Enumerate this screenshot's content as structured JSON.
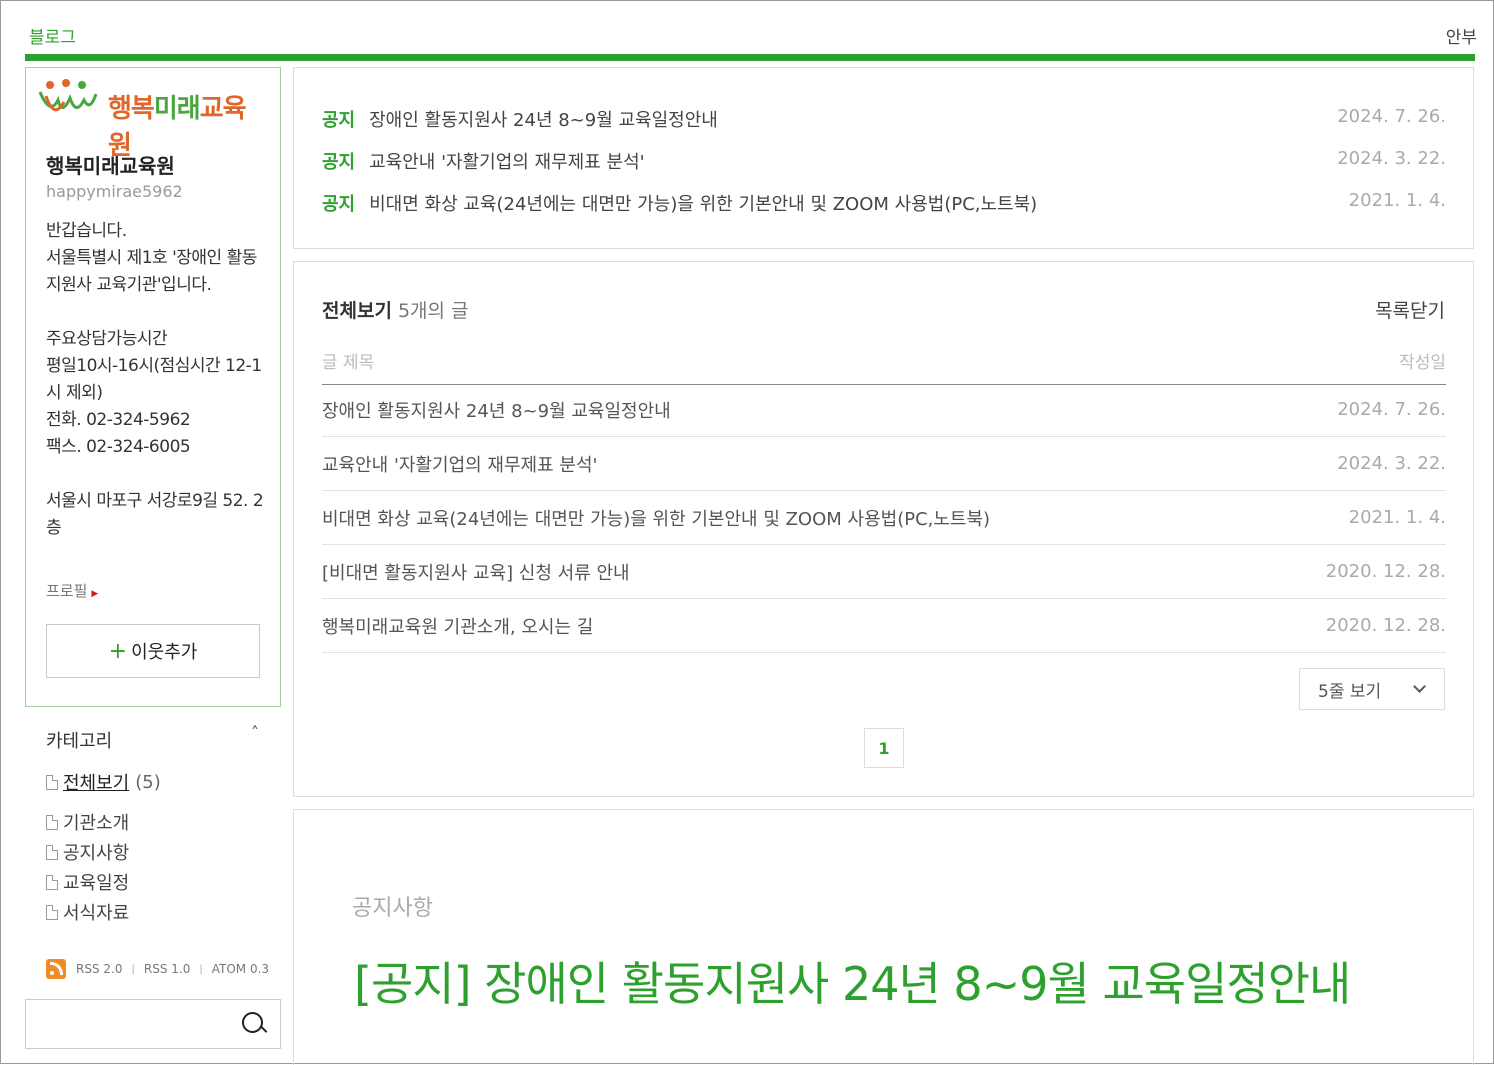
{
  "header": {
    "brand": "블로그",
    "signin": "안부"
  },
  "profile": {
    "logo_text_orange": "행복",
    "logo_text_green": "미래",
    "logo_text_rest": "교육원",
    "name": "행복미래교육원",
    "id": "happymirae5962",
    "intro": "반갑습니다.\n서울특별시 제1호 '장애인 활동지원사 교육기관'입니다.\n\n주요상담가능시간\n평일10시-16시(점심시간 12-1시 제외)\n전화. 02-324-5962\n팩스. 02-324-6005\n\n서울시 마포구 서강로9길 52. 2층",
    "profile_link": "프로필",
    "add_button": "이웃추가"
  },
  "categories": {
    "title": "카테고리",
    "all": {
      "label": "전체보기",
      "count": "(5)"
    },
    "items": [
      "기관소개",
      "공지사항",
      "교육일정",
      "서식자료"
    ]
  },
  "rss": {
    "rss2": "RSS 2.0",
    "rss1": "RSS 1.0",
    "atom": "ATOM 0.3"
  },
  "notices": [
    {
      "tag": "공지",
      "title": "장애인 활동지원사 24년 8~9월 교육일정안내",
      "date": "2024. 7. 26."
    },
    {
      "tag": "공지",
      "title": "교육안내 '자활기업의 재무제표 분석'",
      "date": "2024. 3. 22."
    },
    {
      "tag": "공지",
      "title": "비대면 화상 교육(24년에는 대면만 가능)을 위한 기본안내 및 ZOOM 사용법(PC,노트북)",
      "date": "2021. 1. 4."
    }
  ],
  "list": {
    "title": "전체보기",
    "count": "5개의 글",
    "close": "목록닫기",
    "col_title": "글 제목",
    "col_date": "작성일",
    "rows": [
      {
        "title": "장애인 활동지원사 24년 8~9월 교육일정안내",
        "date": "2024. 7. 26."
      },
      {
        "title": "교육안내 '자활기업의 재무제표 분석'",
        "date": "2024. 3. 22."
      },
      {
        "title": "비대면 화상 교육(24년에는 대면만 가능)을 위한 기본안내 및 ZOOM 사용법(PC,노트북)",
        "date": "2021. 1. 4."
      },
      {
        "title": "[비대면 활동지원사 교육] 신청 서류 안내",
        "date": "2020. 12. 28."
      },
      {
        "title": "행복미래교육원 기관소개, 오시는 길",
        "date": "2020. 12. 28."
      }
    ],
    "rows_select": "5줄 보기",
    "page": "1"
  },
  "post": {
    "category": "공지사항",
    "title": "[공지] 장애인 활동지원사 24년 8~9월 교육일정안내"
  },
  "colors": {
    "accent": "#2ea02e",
    "logo_orange": "#e0662a"
  }
}
